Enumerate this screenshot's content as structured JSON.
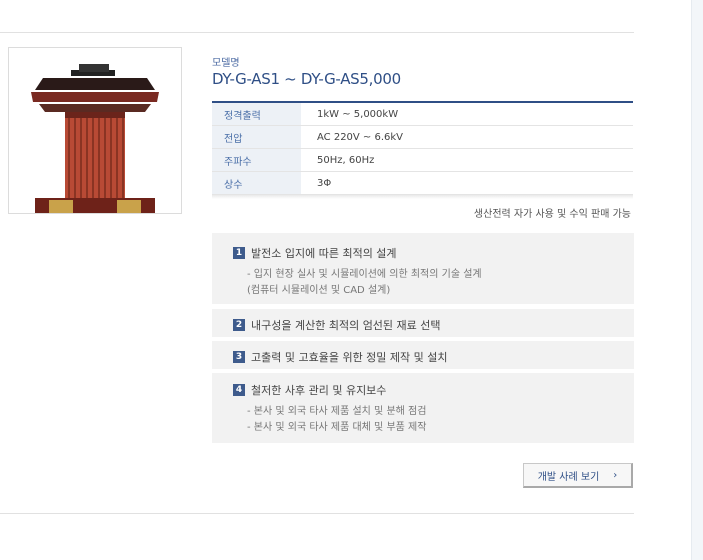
{
  "model": {
    "label": "모델명",
    "title": "DY-G-AS1 ~ DY-G-AS5,000"
  },
  "specs": [
    {
      "key": "정격출력",
      "value": "1kW ~ 5,000kW"
    },
    {
      "key": "전압",
      "value": "AC 220V ~ 6.6kV"
    },
    {
      "key": "주파수",
      "value": "50Hz, 60Hz"
    },
    {
      "key": "상수",
      "value": "3Φ"
    }
  ],
  "note": "생산전력 자가 사용 및 수익 판매 가능",
  "features": [
    {
      "num": "1",
      "title": "발전소 입지에 따른 최적의 설계",
      "subs": [
        "- 입지 현장 실사 및 시뮬레이션에 의한 최적의 기술 설계",
        "(컴퓨터 시뮬레이션 및 CAD 설계)"
      ]
    },
    {
      "num": "2",
      "title": "내구성을 계산한 최적의 엄선된 재료 선택",
      "subs": []
    },
    {
      "num": "3",
      "title": "고출력 및 고효율을 위한 정밀 제작 및 설치",
      "subs": []
    },
    {
      "num": "4",
      "title": "철저한 사후 관리 및 유지보수",
      "subs": [
        "- 본사 및 외국 타사 제품 설치 및 분해 점검",
        "- 본사 및 외국 타사 제품 대체 및 부품 제작"
      ]
    }
  ],
  "button": {
    "label": "개발 사례 보기",
    "icon": "chevron-right-icon"
  },
  "image": {
    "subject": "generator-product-photo"
  },
  "colors": {
    "accent": "#2f4f86",
    "badge": "#3e5b8c",
    "panel": "#f2f2f2"
  }
}
